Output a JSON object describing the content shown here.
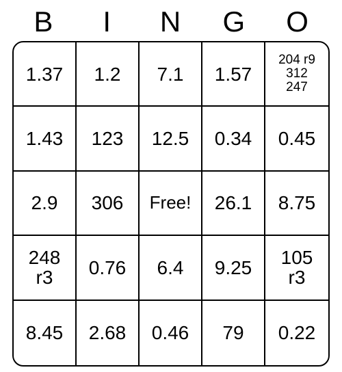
{
  "headers": [
    "B",
    "I",
    "N",
    "G",
    "O"
  ],
  "cells": [
    {
      "text": "1.37",
      "size": ""
    },
    {
      "text": "1.2",
      "size": ""
    },
    {
      "text": "7.1",
      "size": ""
    },
    {
      "text": "1.57",
      "size": ""
    },
    {
      "text": "204 r9\n312\n247",
      "size": "small"
    },
    {
      "text": "1.43",
      "size": ""
    },
    {
      "text": "123",
      "size": ""
    },
    {
      "text": "12.5",
      "size": ""
    },
    {
      "text": "0.34",
      "size": ""
    },
    {
      "text": "0.45",
      "size": ""
    },
    {
      "text": "2.9",
      "size": ""
    },
    {
      "text": "306",
      "size": ""
    },
    {
      "text": "Free!",
      "size": "med"
    },
    {
      "text": "26.1",
      "size": ""
    },
    {
      "text": "8.75",
      "size": ""
    },
    {
      "text": "248\nr3",
      "size": ""
    },
    {
      "text": "0.76",
      "size": ""
    },
    {
      "text": "6.4",
      "size": ""
    },
    {
      "text": "9.25",
      "size": ""
    },
    {
      "text": "105\nr3",
      "size": ""
    },
    {
      "text": "8.45",
      "size": ""
    },
    {
      "text": "2.68",
      "size": ""
    },
    {
      "text": "0.46",
      "size": ""
    },
    {
      "text": "79",
      "size": ""
    },
    {
      "text": "0.22",
      "size": ""
    }
  ]
}
